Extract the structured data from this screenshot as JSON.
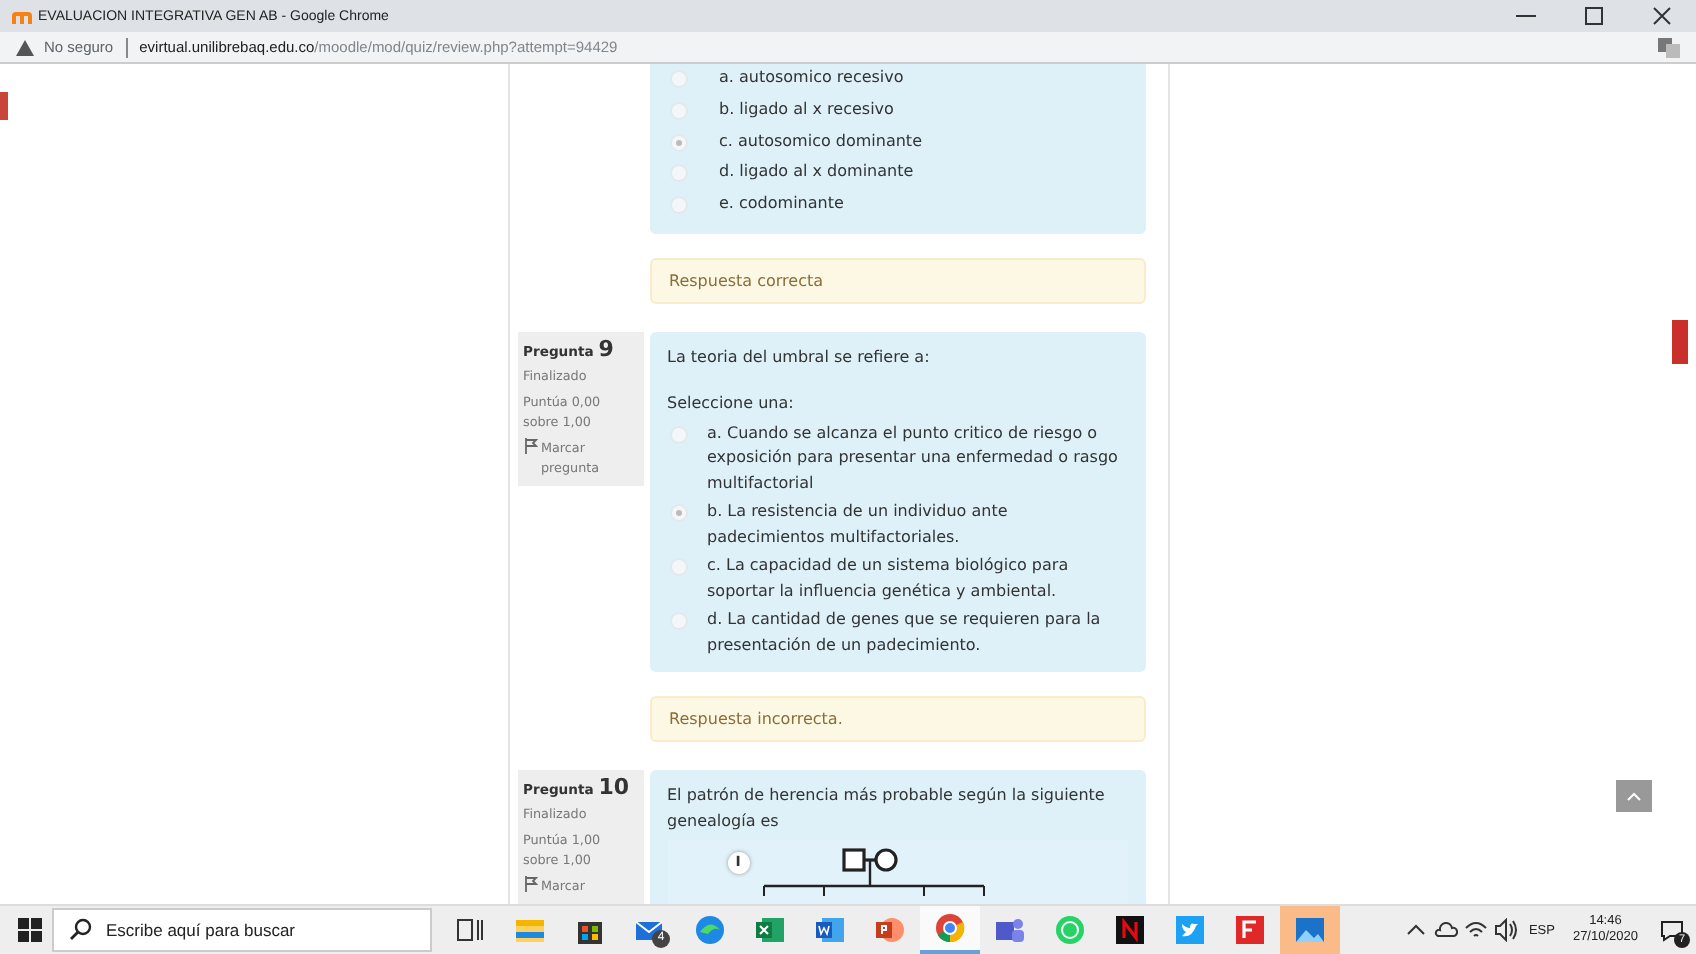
{
  "window": {
    "title": "EVALUACION INTEGRATIVA GEN AB - Google Chrome"
  },
  "address": {
    "security": "No seguro",
    "host": "evirtual.unilibrebaq.edu.co",
    "path": "/moodle/mod/quiz/review.php?attempt=94429"
  },
  "questions": [
    {
      "kind": "partial",
      "options": [
        {
          "label": "a. autosomico recesivo",
          "selected": false
        },
        {
          "label": "b. ligado al x recesivo",
          "selected": false
        },
        {
          "label": "c. autosomico dominante",
          "selected": true
        },
        {
          "label": "d. ligado al x dominante",
          "selected": false
        },
        {
          "label": "e. codominante",
          "selected": false
        }
      ],
      "feedback": "Respuesta correcta"
    },
    {
      "kind": "choice",
      "number_label": "Pregunta",
      "number": "9",
      "state": "Finalizado",
      "grade": "Puntúa 0,00 sobre 1,00",
      "flag": "Marcar pregunta",
      "text": "La teoria del umbral se refiere a:",
      "prompt": "Seleccione una:",
      "options": [
        {
          "label": "a. Cuando se alcanza el punto critico de riesgo o exposición para presentar una enfermedad o rasgo multifactorial",
          "selected": false
        },
        {
          "label": "b. La resistencia de un individuo ante padecimientos multifactoriales.",
          "selected": true
        },
        {
          "label": "c. La capacidad de un sistema biológico para soportar la influencia genética y ambiental.",
          "selected": false
        },
        {
          "label": "d. La cantidad de genes que se requieren para la presentación de un padecimiento.",
          "selected": false
        }
      ],
      "feedback": "Respuesta incorrecta."
    },
    {
      "kind": "figure",
      "number_label": "Pregunta",
      "number": "10",
      "state": "Finalizado",
      "grade": "Puntúa 1,00 sobre 1,00",
      "flag": "Marcar",
      "text": "El patrón de herencia más probable  según la siguiente genealogía es",
      "generation": "I"
    }
  ],
  "taskbar": {
    "search_placeholder": "Escribe aquí para buscar",
    "mail_badge": "4",
    "language": "ESP",
    "time": "14:46",
    "date": "27/10/2020",
    "notifications": "7"
  }
}
